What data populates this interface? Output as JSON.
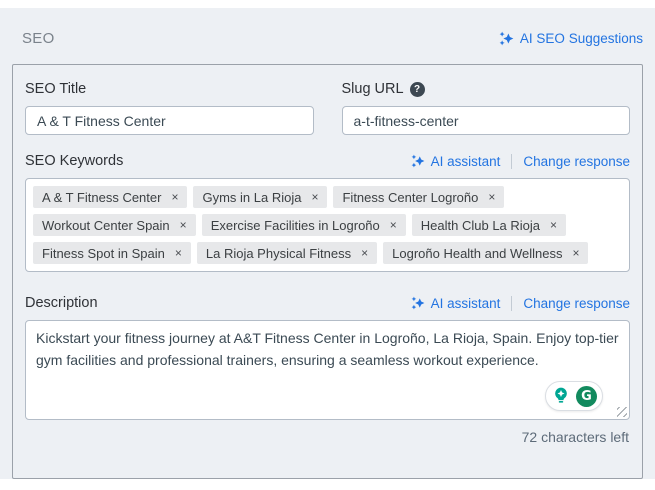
{
  "header": {
    "title": "SEO",
    "ai_suggestions_label": "AI SEO Suggestions"
  },
  "seo_title": {
    "label": "SEO Title",
    "value": "A & T Fitness Center"
  },
  "slug_url": {
    "label": "Slug URL",
    "help_glyph": "?",
    "value": "a-t-fitness-center"
  },
  "keywords": {
    "label": "SEO Keywords",
    "ai_assistant_label": "AI assistant",
    "change_response_label": "Change response",
    "tags": [
      "A & T Fitness Center",
      "Gyms in La Rioja",
      "Fitness Center Logroño",
      "Workout Center Spain",
      "Exercise Facilities in Logroño",
      "Health Club La Rioja",
      "Fitness Spot in Spain",
      "La Rioja Physical Fitness",
      "Logroño Health and Wellness"
    ],
    "remove_glyph": "×"
  },
  "description": {
    "label": "Description",
    "ai_assistant_label": "AI assistant",
    "change_response_label": "Change response",
    "value": "Kickstart your fitness journey at A&T Fitness Center in Logroño, La Rioja, Spain. Enjoy top-tier gym facilities and professional trainers, ensuring a seamless workout experience.",
    "characters_left": "72 characters left",
    "grammarly_glyph": "G"
  },
  "colors": {
    "accent_blue": "#2374e1",
    "teal_bulb": "#00a693",
    "grammarly_green": "#128a5e",
    "chip_bg": "#e7e8ea",
    "section_bg": "#edf0f4"
  }
}
